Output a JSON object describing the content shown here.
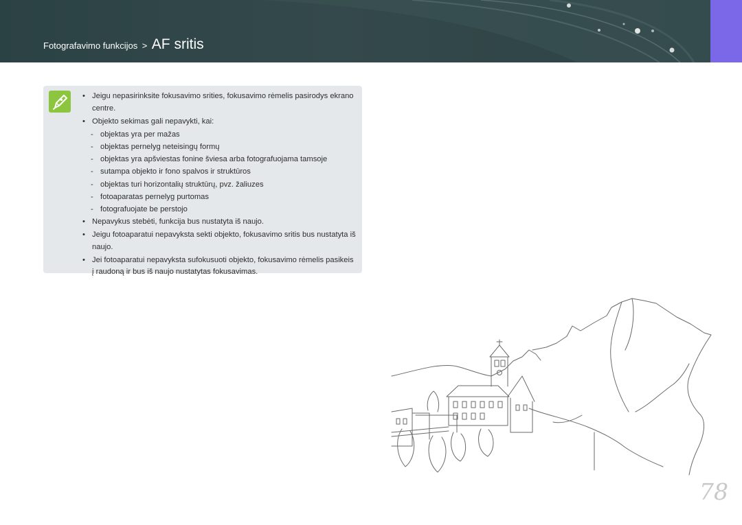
{
  "header": {
    "breadcrumb": "Fotografavimo funkcijos",
    "separator": ">",
    "title": "AF sritis",
    "background_color": "#34494b",
    "tab_color": "#7b68e8"
  },
  "note": {
    "icon": "pen-icon",
    "icon_color": "#8cc63f",
    "background_color": "#e4e8ea",
    "bullet": "•",
    "dash": "-",
    "items": [
      {
        "text": "Jeigu nepasirinksite fokusavimo srities, fokusavimo rėmelis pasirodys ekrano centre."
      },
      {
        "text": "Objekto sekimas gali nepavykti, kai:",
        "subitems": [
          "objektas yra per mažas",
          "objektas pernelyg neteisingų formų",
          "objektas yra apšviestas fonine šviesa arba fotografuojama tamsoje",
          "sutampa objekto ir fono spalvos ir struktūros",
          "objektas turi horizontalių struktūrų, pvz. žaliuzes",
          "fotoaparatas pernelyg purtomas",
          "fotografuojate be perstojo"
        ]
      },
      {
        "text": "Nepavykus stebėti, funkcija bus nustatyta iš naujo."
      },
      {
        "text": "Jeigu fotoaparatui nepavyksta sekti objekto, fokusavimo sritis bus nustatyta iš naujo."
      },
      {
        "text": "Jei fotoaparatui nepavyksta sufokusuoti objekto, fokusavimo rėmelis pasikeis į raudoną ir bus iš naujo nustatytas fokusavimas."
      }
    ]
  },
  "page_number": "78"
}
